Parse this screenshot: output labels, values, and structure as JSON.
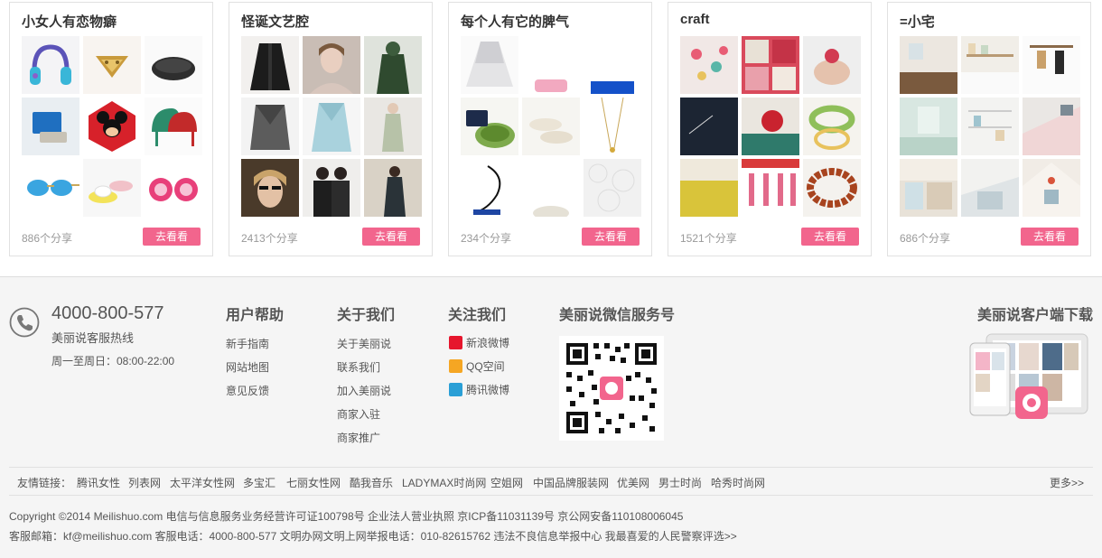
{
  "boards": [
    {
      "title": "小女人有恋物癖",
      "count": "886个分享",
      "button": "去看看"
    },
    {
      "title": "怪诞文艺腔",
      "count": "2413个分享",
      "button": "去看看"
    },
    {
      "title": "每个人有它的脾气",
      "count": "234个分享",
      "button": "去看看"
    },
    {
      "title": "craft",
      "count": "1521个分享",
      "button": "去看看"
    },
    {
      "title": "=小宅",
      "count": "686个分享",
      "button": "去看看"
    }
  ],
  "footer": {
    "hotline": "4000-800-577",
    "hotline_label": "美丽说客服热线",
    "hours": "周一至周日：08:00-22:00",
    "help": {
      "title": "用户帮助",
      "links": [
        "新手指南",
        "网站地图",
        "意见反馈"
      ]
    },
    "about": {
      "title": "关于我们",
      "links": [
        "关于美丽说",
        "联系我们",
        "加入美丽说",
        "商家入驻",
        "商家推广"
      ]
    },
    "follow": {
      "title": "关注我们",
      "links": [
        "新浪微博",
        "QQ空间",
        "腾讯微博"
      ]
    },
    "wechat": {
      "title": "美丽说微信服务号"
    },
    "app": {
      "title": "美丽说客户端下载"
    },
    "friend_links": {
      "label": "友情链接：",
      "links": [
        "腾讯女性",
        "列表网",
        "太平洋女性网",
        "多宝汇",
        "七丽女性网",
        "酷我音乐",
        "LADYMAX时尚网",
        "空姐网",
        "中国品牌服装网",
        "优美网",
        "男士时尚",
        "哈秀时尚网"
      ],
      "more": "更多>>"
    },
    "copyright_1": "Copyright ©2014 Meilishuo.com  电信与信息服务业务经营许可证100798号  企业法人营业执照  京ICP备11031139号  京公网安备110108006045",
    "copyright_2": "客服邮箱：kf@meilishuo.com  客服电话：4000-800-577  文明办网文明上网举报电话：010-82615762  违法不良信息举报中心  我最喜爱的人民警察评选>>"
  },
  "colors": {
    "accent": "#f2658d",
    "weibo": "#e6162d",
    "qzone": "#f5a623",
    "tencent": "#2a9fd6"
  }
}
